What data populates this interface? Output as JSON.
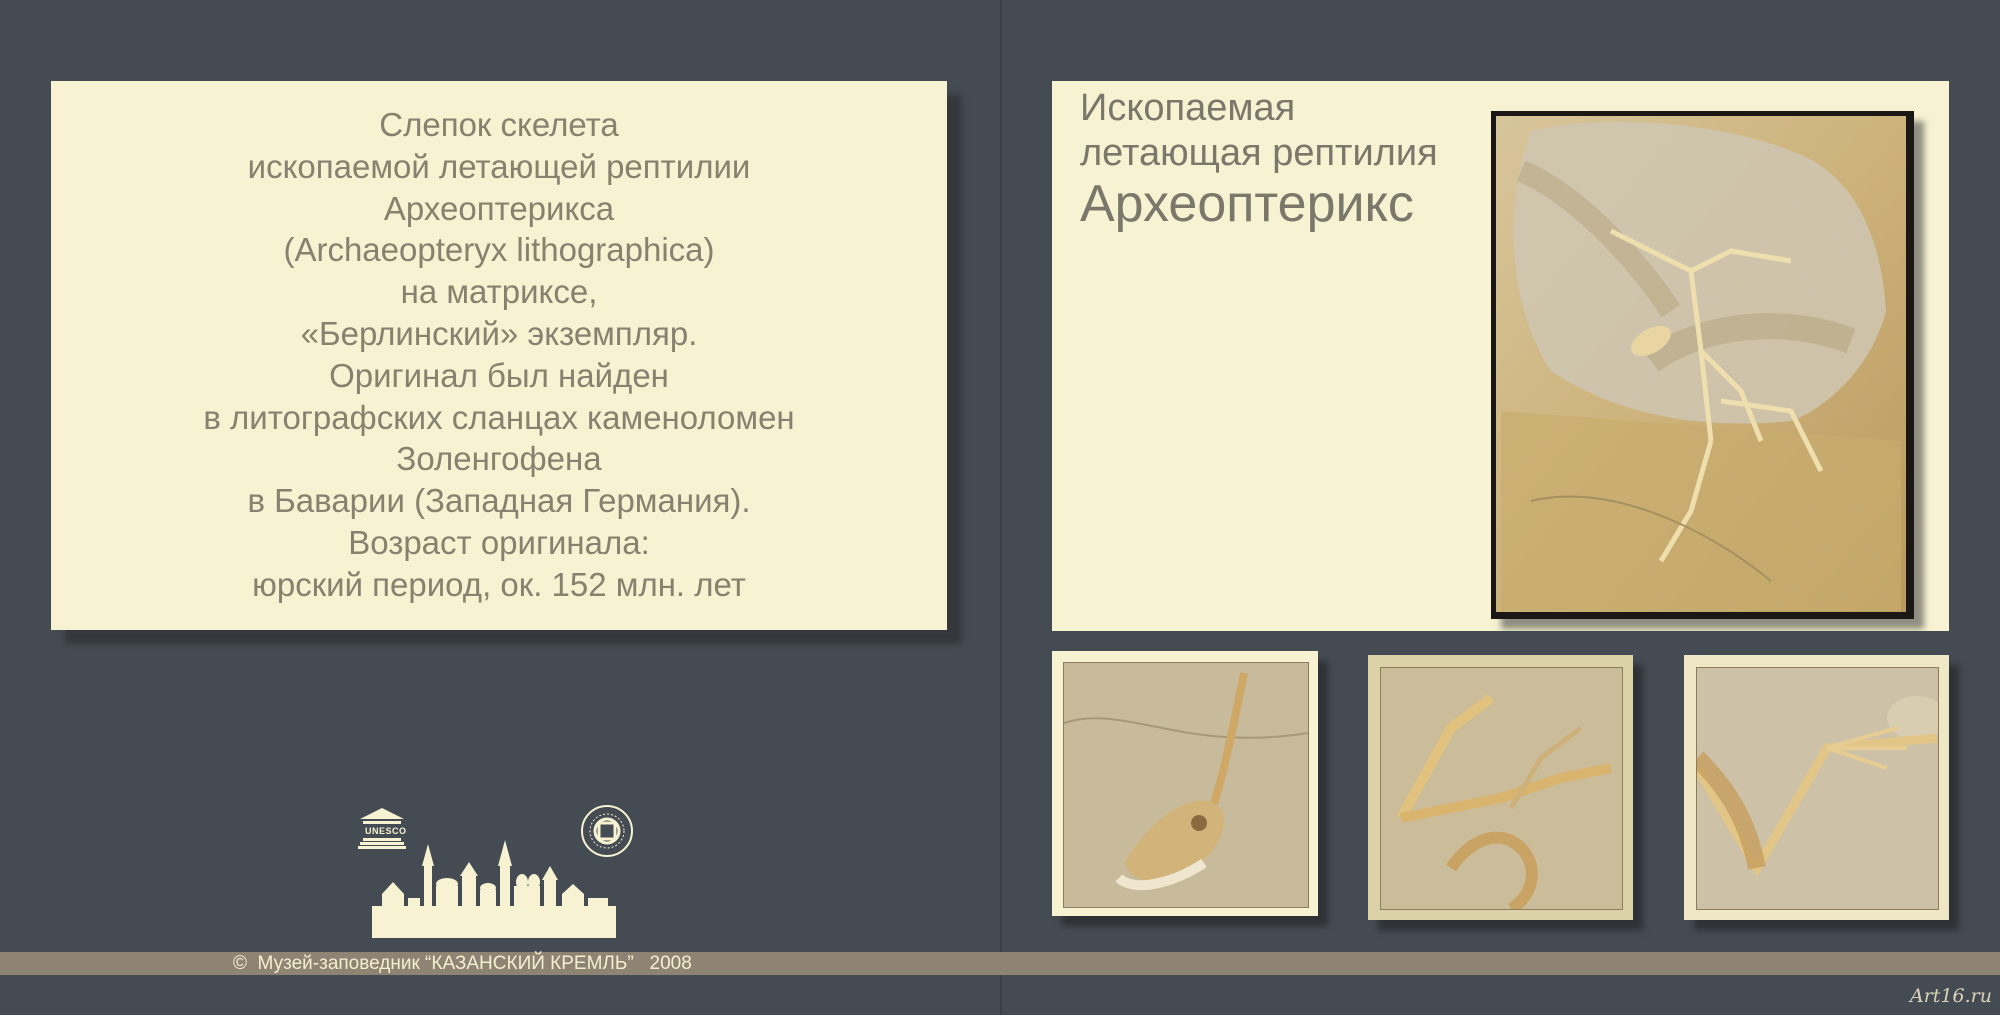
{
  "description": {
    "lines": [
      "Слепок скелета",
      "ископаемой летающей рептилии",
      "Археоптерикса",
      "(Archaeopteryx lithographica)",
      "на матриксе,",
      "«Берлинский» экземпляр.",
      "Оригинал был найден",
      "в литографских сланцах каменоломен",
      "Золенгофена",
      "в Баварии (Западная Германия).",
      "Возраст оригинала:",
      "юрский период, ок. 152 млн. лет"
    ]
  },
  "title": {
    "line1": "Ископаемая",
    "line2": "летающая рептилия",
    "line3": "Археоптерикс"
  },
  "logos": {
    "unesco": "UNESCO",
    "heritage_icon": "world-heritage-emblem",
    "kremlin_icon": "kazan-kremlin-silhouette"
  },
  "footer": {
    "copyright": "©  Музей-заповедник “КАЗАНСКИЙ КРЕМЛЬ”   2008"
  },
  "watermark": "Art16.ru",
  "colors": {
    "background": "#444b53",
    "card": "#f7f2d2",
    "text": "#86826f",
    "stripe": "#8d8474"
  }
}
